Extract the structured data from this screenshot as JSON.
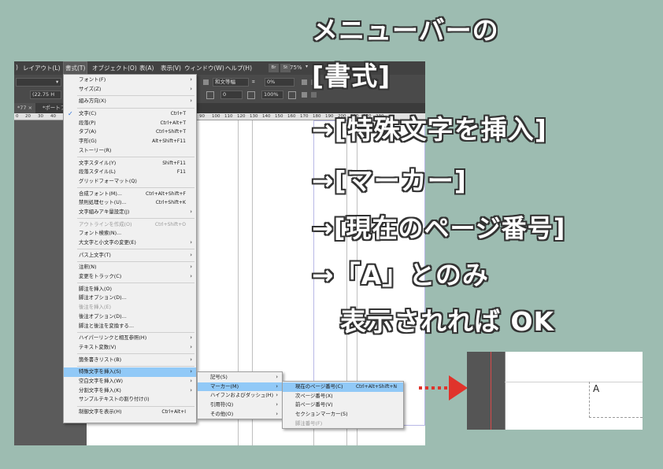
{
  "menubar": {
    "items": [
      "レイアウト(L)",
      "書式(T)",
      "オブジェクト(O)",
      "表(A)",
      "表示(V)",
      "ウィンドウ(W)",
      "ヘルプ(H)"
    ],
    "buttons": [
      "Br",
      "St"
    ],
    "zoom": "75%"
  },
  "controlbar": {
    "size_value": "(22.75 H",
    "spacing_value": "0%",
    "mojikumi": "和文等幅",
    "field_zero": "0",
    "field_hundred": "100%"
  },
  "tabs": [
    "*77",
    "*ポートフォ"
  ],
  "ruler": [
    "0",
    "20",
    "30",
    "40",
    "90",
    "100",
    "110",
    "120",
    "130",
    "140",
    "150",
    "160",
    "170",
    "180",
    "190",
    "200",
    "210",
    "220",
    "230"
  ],
  "format_menu": {
    "groups": [
      [
        {
          "label": "フォント(F)",
          "arrow": true
        },
        {
          "label": "サイズ(Z)",
          "arrow": true
        }
      ],
      [
        {
          "label": "組み方向(X)",
          "arrow": true
        }
      ],
      [
        {
          "label": "文字(C)",
          "shortcut": "Ctrl+T",
          "checked": true
        },
        {
          "label": "段落(P)",
          "shortcut": "Ctrl+Alt+T"
        },
        {
          "label": "タブ(A)",
          "shortcut": "Ctrl+Shift+T"
        },
        {
          "label": "字形(G)",
          "shortcut": "Alt+Shift+F11"
        },
        {
          "label": "ストーリー(R)"
        }
      ],
      [
        {
          "label": "文字スタイル(Y)",
          "shortcut": "Shift+F11"
        },
        {
          "label": "段落スタイル(L)",
          "shortcut": "F11"
        },
        {
          "label": "グリッドフォーマット(Q)"
        }
      ],
      [
        {
          "label": "合成フォント(M)...",
          "shortcut": "Ctrl+Alt+Shift+F"
        },
        {
          "label": "禁則処理セット(U)...",
          "shortcut": "Ctrl+Shift+K"
        },
        {
          "label": "文字組みアキ量設定(J)",
          "arrow": true
        }
      ],
      [
        {
          "label": "アウトラインを作成(O)",
          "shortcut": "Ctrl+Shift+O",
          "disabled": true
        },
        {
          "label": "フォント検索(N)..."
        },
        {
          "label": "大文字と小文字の変更(E)",
          "arrow": true
        }
      ],
      [
        {
          "label": "パス上文字(T)",
          "arrow": true
        }
      ],
      [
        {
          "label": "注釈(N)",
          "arrow": true
        },
        {
          "label": "変更をトラック(C)",
          "arrow": true
        }
      ],
      [
        {
          "label": "脚注を挿入(O)"
        },
        {
          "label": "脚注オプション(D)..."
        },
        {
          "label": "後注を挿入(E)",
          "disabled": true
        },
        {
          "label": "後注オプション(D)..."
        },
        {
          "label": "脚注と後注を変換する..."
        }
      ],
      [
        {
          "label": "ハイパーリンクと相互参照(H)",
          "arrow": true
        },
        {
          "label": "テキスト変数(V)",
          "arrow": true
        }
      ],
      [
        {
          "label": "箇条書きリスト(B)",
          "arrow": true
        }
      ],
      [
        {
          "label": "特殊文字を挿入(S)",
          "arrow": true,
          "highlight": true
        },
        {
          "label": "空白文字を挿入(W)",
          "arrow": true
        },
        {
          "label": "分割文字を挿入(K)",
          "arrow": true
        },
        {
          "label": "サンプルテキストの割り付け(I)"
        }
      ],
      [
        {
          "label": "制御文字を表示(H)",
          "shortcut": "Ctrl+Alt+I"
        }
      ]
    ]
  },
  "special_menu": [
    {
      "label": "記号(S)",
      "arrow": true
    },
    {
      "label": "マーカー(M)",
      "arrow": true,
      "highlight": true
    },
    {
      "label": "ハイフンおよびダッシュ(H)",
      "arrow": true
    },
    {
      "label": "引用符(Q)",
      "arrow": true
    },
    {
      "label": "その他(O)",
      "arrow": true
    }
  ],
  "marker_menu": [
    {
      "label": "現在のページ番号(C)",
      "shortcut": "Ctrl+Alt+Shift+N",
      "highlight": true
    },
    {
      "label": "次ページ番号(X)"
    },
    {
      "label": "前ページ番号(V)"
    },
    {
      "label": "セクションマーカー(S)"
    },
    {
      "label": "脚注番号(F)",
      "disabled": true
    }
  ],
  "annotation": {
    "lines": [
      "メニューバーの",
      "[書式]",
      "→[特殊文字を挿入]",
      "→[マーカー]",
      "→[現在のページ番号]",
      "→「A」とのみ",
      "表示されれば OK"
    ]
  },
  "detail": {
    "page_letter": "A"
  },
  "colors": {
    "background": "#9dbcb1",
    "highlight": "#91c9f7",
    "arrow": "#e0332b"
  }
}
